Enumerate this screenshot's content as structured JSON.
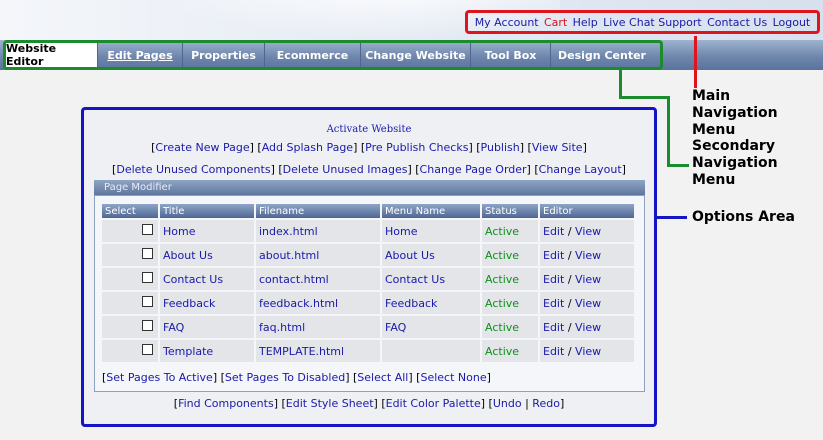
{
  "main_nav": {
    "items": [
      "My Account",
      "Cart",
      "Help",
      "Live Chat Support",
      "Contact Us",
      "Logout"
    ]
  },
  "secondary_nav": {
    "tabs": [
      "Website Editor",
      "Edit Pages",
      "Properties",
      "Ecommerce",
      "Change Website",
      "Tool Box",
      "Design Center"
    ]
  },
  "options": {
    "activate_label": "Activate Website",
    "links_row1": [
      "Create New Page",
      "Add Splash Page",
      "Pre Publish Checks",
      "Publish",
      "View Site"
    ],
    "links_row2": [
      "Delete Unused Components",
      "Delete Unused Images",
      "Change Page Order",
      "Change Layout"
    ],
    "modifier_title": "Page Modifier",
    "columns": [
      "Select",
      "Title",
      "Filename",
      "Menu Name",
      "Status",
      "Editor"
    ],
    "rows": [
      {
        "title": "Home",
        "filename": "index.html",
        "menu": "Home",
        "status": "Active",
        "edit": "Edit",
        "view": "View"
      },
      {
        "title": "About Us",
        "filename": "about.html",
        "menu": "About Us",
        "status": "Active",
        "edit": "Edit",
        "view": "View"
      },
      {
        "title": "Contact Us",
        "filename": "contact.html",
        "menu": "Contact Us",
        "status": "Active",
        "edit": "Edit",
        "view": "View"
      },
      {
        "title": "Feedback",
        "filename": "feedback.html",
        "menu": "Feedback",
        "status": "Active",
        "edit": "Edit",
        "view": "View"
      },
      {
        "title": "FAQ",
        "filename": "faq.html",
        "menu": "FAQ",
        "status": "Active",
        "edit": "Edit",
        "view": "View"
      },
      {
        "title": "Template",
        "filename": "TEMPLATE.html",
        "menu": "",
        "status": "Active",
        "edit": "Edit",
        "view": "View"
      }
    ],
    "bottom_links": [
      "Set Pages To Active",
      "Set Pages To Disabled",
      "Select All",
      "Select None"
    ],
    "footer_links": [
      "Find Components",
      "Edit Style Sheet",
      "Edit Color Palette",
      "Undo",
      "Redo"
    ]
  },
  "annotations": {
    "main_nav": "Main Navigation Menu",
    "secondary_nav": "Secondary Navigation Menu",
    "options_area": "Options Area"
  },
  "colors": {
    "main_nav_box": "#e0141c",
    "secondary_nav_box": "#1b8c2e",
    "options_box": "#1515c8",
    "status_active": "#0f8f1a",
    "link": "#1a1aa8"
  }
}
